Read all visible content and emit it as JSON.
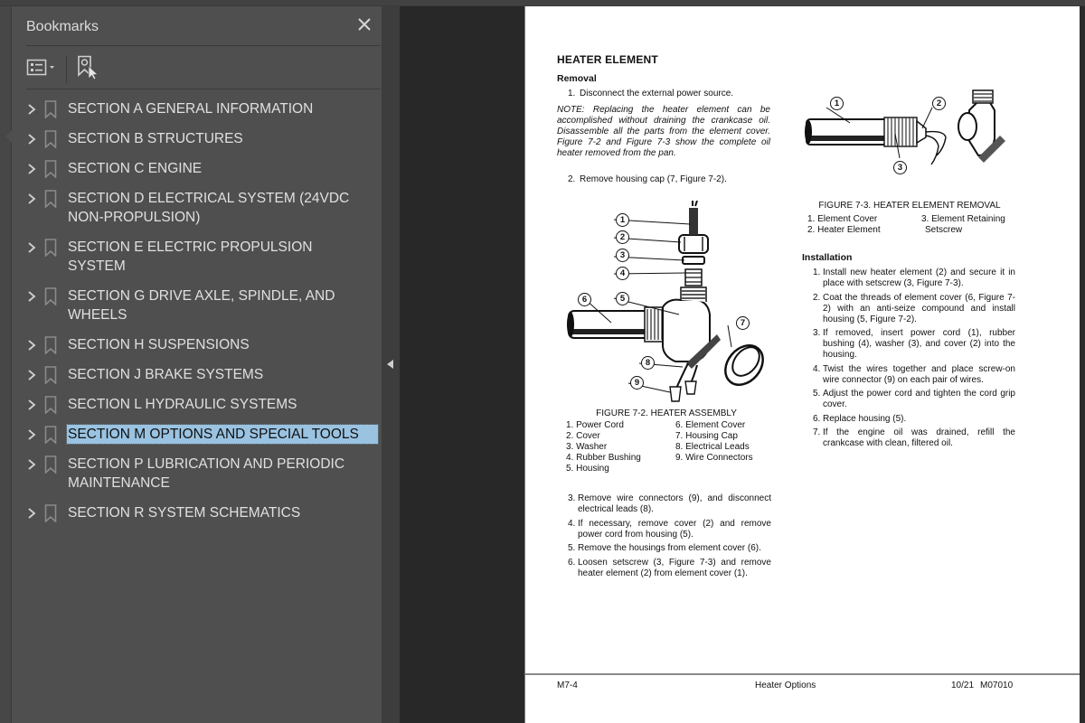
{
  "app": {
    "colors": {
      "panel_bg": "#4f4f4f",
      "viewer_bg": "#282828",
      "selection": "#9ac3e2",
      "text": "#e0e0e0"
    }
  },
  "bookmarks_panel": {
    "title": "Bookmarks",
    "close_icon": "close-icon",
    "toolbar": {
      "options_icon": "list-options-icon",
      "new_bookmark_icon": "new-bookmark-icon"
    },
    "items": [
      {
        "label": "SECTION A GENERAL INFORMATION",
        "selected": false
      },
      {
        "label": "SECTION B STRUCTURES",
        "selected": false
      },
      {
        "label": "SECTION C ENGINE",
        "selected": false
      },
      {
        "label": "SECTION D ELECTRICAL SYSTEM (24VDC NON-PROPULSION)",
        "selected": false
      },
      {
        "label": "SECTION E ELECTRIC PROPULSION SYSTEM",
        "selected": false
      },
      {
        "label": "SECTION G DRIVE AXLE, SPINDLE, AND WHEELS",
        "selected": false
      },
      {
        "label": "SECTION H SUSPENSIONS",
        "selected": false
      },
      {
        "label": "SECTION J BRAKE SYSTEMS",
        "selected": false
      },
      {
        "label": "SECTION L HYDRAULIC SYSTEMS",
        "selected": false
      },
      {
        "label": "SECTION M OPTIONS AND SPECIAL TOOLS",
        "selected": true
      },
      {
        "label": "SECTION P LUBRICATION AND PERIODIC MAINTENANCE",
        "selected": false
      },
      {
        "label": "SECTION R SYSTEM SCHEMATICS",
        "selected": false
      }
    ]
  },
  "document": {
    "heading": "HEATER ELEMENT",
    "removal": {
      "title": "Removal",
      "step1": {
        "num": "1.",
        "text": "Disconnect the external power source."
      },
      "note": "NOTE: Replacing the heater element can be accomplished without draining the crankcase oil. Disassemble all the parts from the element cover. Figure 7-2 and Figure 7-3 show the complete oil heater removed from the pan.",
      "step2": {
        "num": "2.",
        "text": "Remove housing cap (7, Figure 7-2)."
      },
      "later_steps": [
        {
          "num": "3.",
          "text": "Remove wire connectors (9), and disconnect electrical leads (8)."
        },
        {
          "num": "4.",
          "text": "If necessary, remove cover (2) and remove power cord from housing (5)."
        },
        {
          "num": "5.",
          "text": "Remove the housings from element cover (6)."
        },
        {
          "num": "6.",
          "text": "Loosen setscrew (3, Figure 7-3) and remove heater element (2) from element cover (1)."
        }
      ]
    },
    "figure_7_2": {
      "caption": "FIGURE 7-2. HEATER ASSEMBLY",
      "callouts": [
        "1",
        "2",
        "3",
        "4",
        "5",
        "6",
        "7",
        "8",
        "9"
      ],
      "legend_left": [
        "1. Power Cord",
        "2. Cover",
        "3. Washer",
        "4. Rubber Bushing",
        "5. Housing"
      ],
      "legend_right": [
        "6. Element Cover",
        "7. Housing Cap",
        "8. Electrical Leads",
        "9. Wire Connectors"
      ]
    },
    "figure_7_3": {
      "caption": "FIGURE 7-3. HEATER ELEMENT REMOVAL",
      "callouts": [
        "1",
        "2",
        "3"
      ],
      "legend_left": [
        "1. Element Cover",
        "2. Heater Element"
      ],
      "legend_right": [
        "3. Element Retaining",
        "Setscrew"
      ]
    },
    "installation": {
      "title": "Installation",
      "steps": [
        {
          "num": "1.",
          "text": "Install new heater element (2) and secure it in place with setscrew (3, Figure 7-3)."
        },
        {
          "num": "2.",
          "text": "Coat the threads of element cover (6, Figure 7-2) with an anti-seize compound and install housing (5, Figure 7-2)."
        },
        {
          "num": "3.",
          "text": "If removed, insert power cord (1), rubber bushing (4), washer (3), and cover (2) into the housing."
        },
        {
          "num": "4.",
          "text": "Twist the wires together and place screw-on wire connector (9) on each pair of wires."
        },
        {
          "num": "5.",
          "text": "Adjust the power cord and tighten the cord grip cover."
        },
        {
          "num": "6.",
          "text": "Replace housing (5)."
        },
        {
          "num": "7.",
          "text": "If the engine oil was drained, refill the crankcase with clean, filtered oil."
        }
      ]
    },
    "footer": {
      "page": "M7-4",
      "title": "Heater Options",
      "date": "10/21",
      "doc_id": "M07010"
    }
  }
}
